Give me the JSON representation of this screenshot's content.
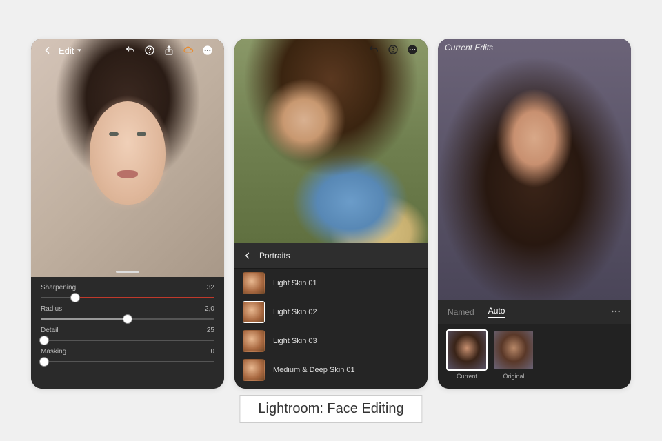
{
  "caption": "Lightroom: Face Editing",
  "phone1": {
    "edit_label": "Edit",
    "sliders": [
      {
        "label": "Sharpening",
        "value": "32",
        "pos": 20
      },
      {
        "label": "Radius",
        "value": "2,0",
        "pos": 50
      },
      {
        "label": "Detail",
        "value": "25",
        "pos": 0
      },
      {
        "label": "Masking",
        "value": "0",
        "pos": 0
      }
    ]
  },
  "phone2": {
    "category": "Portraits",
    "presets": [
      {
        "label": "Light Skin 01",
        "selected": false
      },
      {
        "label": "Light Skin 02",
        "selected": true
      },
      {
        "label": "Light Skin 03",
        "selected": false
      },
      {
        "label": "Medium & Deep Skin 01",
        "selected": false
      }
    ]
  },
  "phone3": {
    "title": "Current Edits",
    "tabs": {
      "named": "Named",
      "auto": "Auto"
    },
    "versions": {
      "current": "Current",
      "original": "Original"
    }
  }
}
